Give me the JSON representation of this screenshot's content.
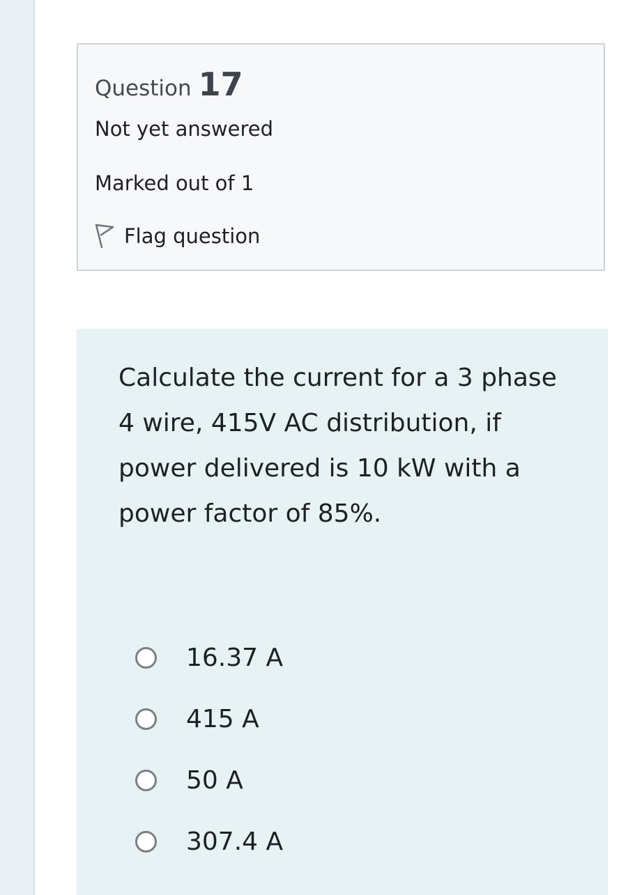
{
  "question": {
    "label": "Question",
    "number": "17",
    "state": "Not yet answered",
    "grade": "Marked out of 1",
    "flag_label": "Flag question"
  },
  "text": "Calculate the current for a 3 phase 4 wire, 415V AC distribution, if power delivered is 10 kW with a power factor of 85%.",
  "answers": [
    {
      "label": "16.37 A"
    },
    {
      "label": "415 A"
    },
    {
      "label": "50 A"
    },
    {
      "label": "307.4 A"
    }
  ],
  "icons": {
    "flag": "flag-icon",
    "radio": "radio-unchecked-icon"
  }
}
